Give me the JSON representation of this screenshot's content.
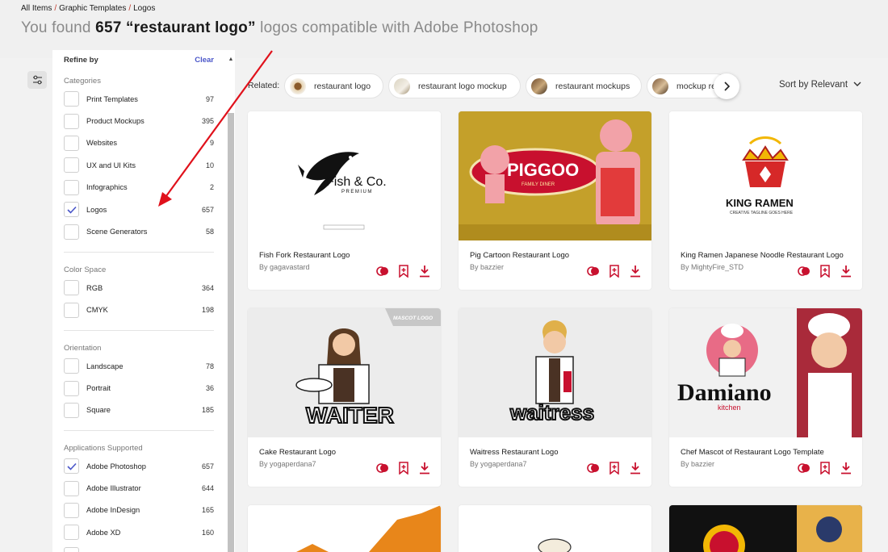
{
  "breadcrumb": [
    "All Items",
    "Graphic Templates",
    "Logos"
  ],
  "headline": {
    "prefix": "You found ",
    "count": "657",
    "query": "“restaurant logo”",
    "suffix": " logos compatible with Adobe Photoshop"
  },
  "sidebar": {
    "refine_label": "Refine by",
    "clear_label": "Clear",
    "groups": [
      {
        "title": "Categories",
        "options": [
          {
            "label": "Print Templates",
            "count": "97",
            "checked": false
          },
          {
            "label": "Product Mockups",
            "count": "395",
            "checked": false
          },
          {
            "label": "Websites",
            "count": "9",
            "checked": false
          },
          {
            "label": "UX and UI Kits",
            "count": "10",
            "checked": false
          },
          {
            "label": "Infographics",
            "count": "2",
            "checked": false
          },
          {
            "label": "Logos",
            "count": "657",
            "checked": true
          },
          {
            "label": "Scene Generators",
            "count": "58",
            "checked": false
          }
        ]
      },
      {
        "title": "Color Space",
        "options": [
          {
            "label": "RGB",
            "count": "364",
            "checked": false
          },
          {
            "label": "CMYK",
            "count": "198",
            "checked": false
          }
        ]
      },
      {
        "title": "Orientation",
        "options": [
          {
            "label": "Landscape",
            "count": "78",
            "checked": false
          },
          {
            "label": "Portrait",
            "count": "36",
            "checked": false
          },
          {
            "label": "Square",
            "count": "185",
            "checked": false
          }
        ]
      },
      {
        "title": "Applications Supported",
        "options": [
          {
            "label": "Adobe Photoshop",
            "count": "657",
            "checked": true
          },
          {
            "label": "Adobe Illustrator",
            "count": "644",
            "checked": false
          },
          {
            "label": "Adobe InDesign",
            "count": "165",
            "checked": false
          },
          {
            "label": "Adobe XD",
            "count": "160",
            "checked": false
          }
        ]
      }
    ]
  },
  "related": {
    "label": "Related:",
    "chips": [
      "restaurant logo",
      "restaurant logo mockup",
      "restaurant mockups",
      "mockup re"
    ]
  },
  "sort_label": "Sort by Relevant",
  "cards": [
    {
      "title": "Fish Fork Restaurant Logo",
      "author": "By gagavastard",
      "art_text": "Fish & Co.",
      "art_sub": "PREMIUM",
      "badge": ""
    },
    {
      "title": "Pig Cartoon Restaurant Logo",
      "author": "By bazzier",
      "art_text": "PIGGOO",
      "art_sub": "FAMILY DINER",
      "badge": ""
    },
    {
      "title": "King Ramen Japanese Noodle Restaurant Logo",
      "author": "By MightyFire_STD",
      "art_text": "KING RAMEN",
      "art_sub": "CREATIVE TAGLINE GOES HERE",
      "badge": ""
    },
    {
      "title": "Cake Restaurant Logo",
      "author": "By yogaperdana7",
      "art_text": "WAITER",
      "art_sub": "",
      "badge": "MASCOT LOGO"
    },
    {
      "title": "Waitress Restaurant Logo",
      "author": "By yogaperdana7",
      "art_text": "waitress",
      "art_sub": "",
      "badge": ""
    },
    {
      "title": "Chef Mascot of Restaurant Logo Template",
      "author": "By bazzier",
      "art_text": "Damiano",
      "art_sub": "kitchen",
      "badge": ""
    }
  ],
  "colors": {
    "accent": "#c8102e",
    "link": "#4a56c9",
    "checkmark": "#4a56c9"
  }
}
